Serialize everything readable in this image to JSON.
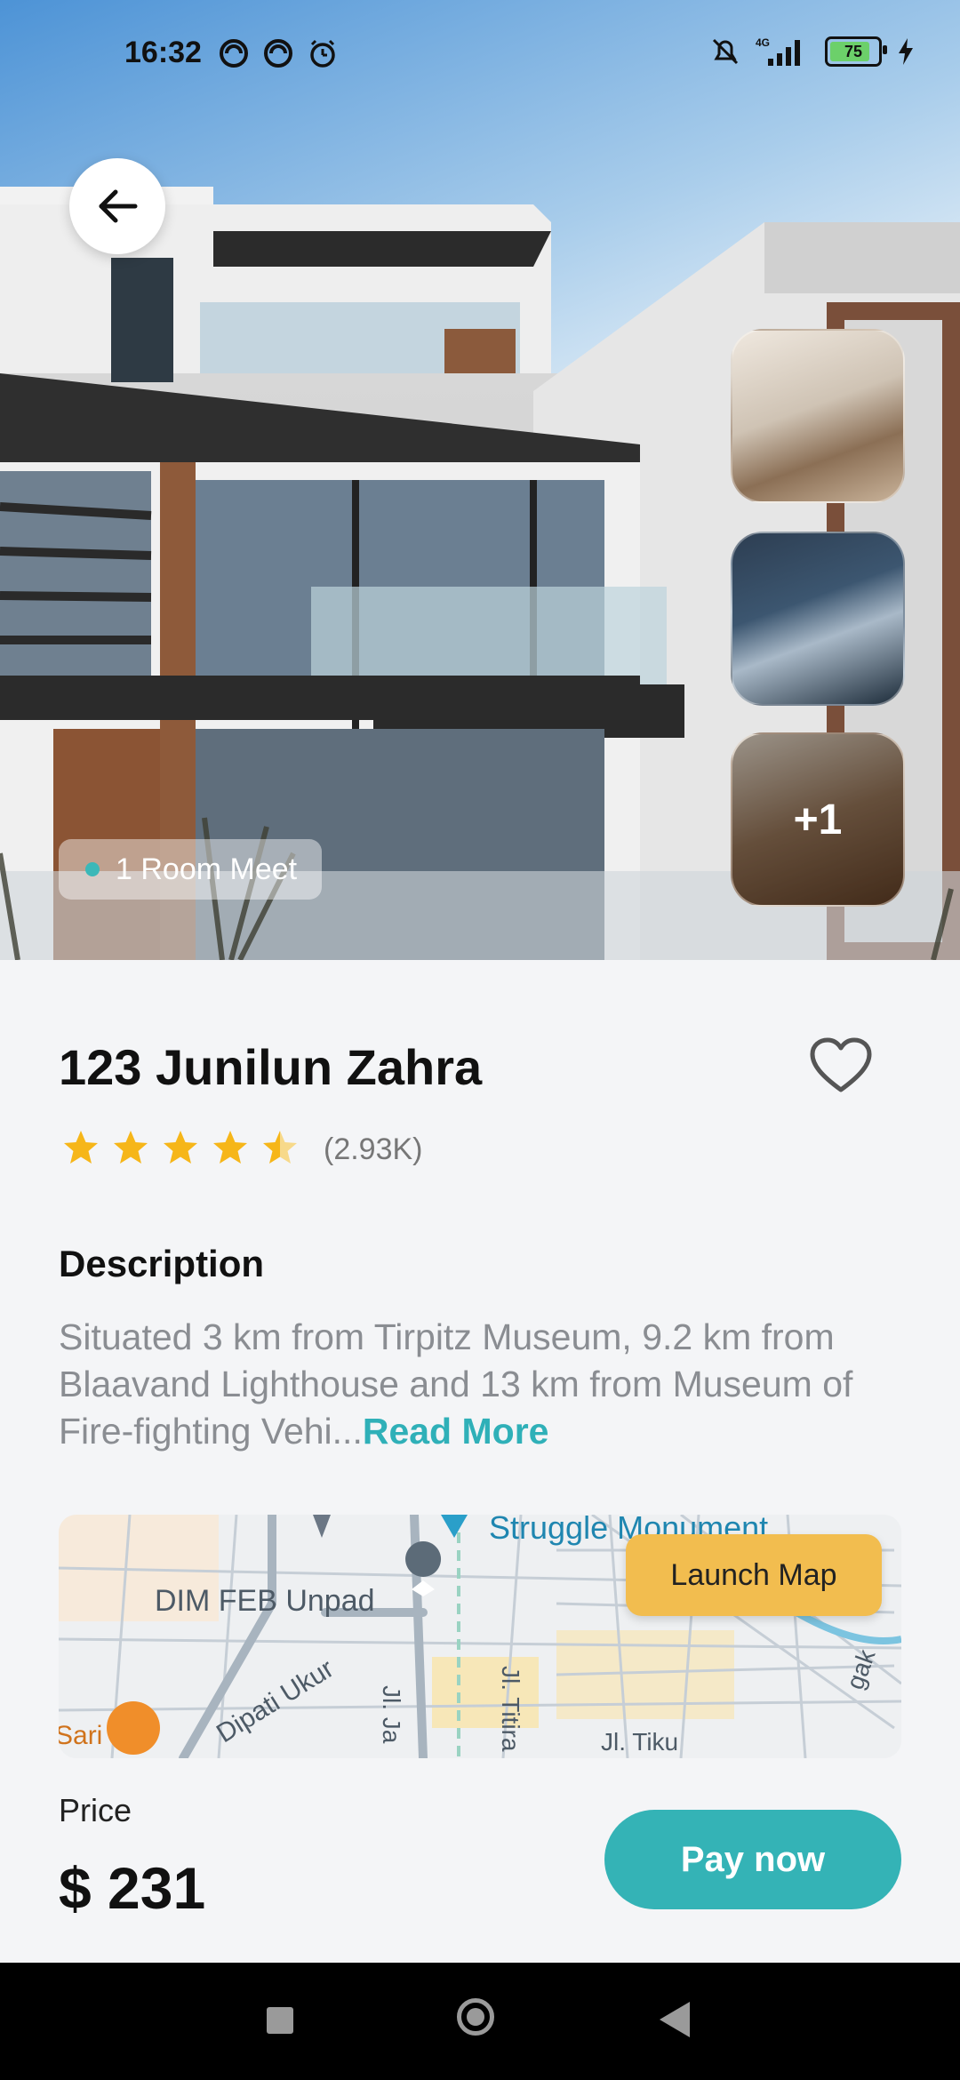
{
  "status_bar": {
    "time": "16:32",
    "battery_level": "75",
    "network": "4G",
    "icons_left": [
      "sync-icon",
      "sync-icon",
      "alarm-icon"
    ],
    "icons_right": [
      "mute-icon",
      "network-4g-icon",
      "signal-icon",
      "battery-icon",
      "charging-icon"
    ]
  },
  "hero": {
    "room_tag": "1 Room Meet",
    "more_photos_label": "+1",
    "thumbnails": [
      "living-room",
      "meeting-room",
      "staircase"
    ]
  },
  "property": {
    "title": "123 Junilun Zahra",
    "rating": 4.5,
    "rating_max": 5,
    "rating_count": "(2.93K)"
  },
  "description": {
    "heading": "Description",
    "text": "Situated 3 km from Tirpitz Museum, 9.2 km from Blaavand Lighthouse and 13 km from Museum of Fire-fighting Vehi...",
    "read_more": "Read More"
  },
  "map": {
    "labels": {
      "monument": "Struggle Monument",
      "campus": "DIM FEB Unpad",
      "road1": "Dipati Ukur",
      "road2": "Jl. Titira",
      "road3": "Jl. Tiku",
      "road4": "Jl. Ja",
      "road5": "Sari",
      "road6": "gak"
    },
    "launch_label": "Launch Map"
  },
  "checkout": {
    "price_label": "Price",
    "price_value": "$ 231",
    "pay_label": "Pay now"
  },
  "colors": {
    "accent": "#34b3b6",
    "star": "#f6b619",
    "launch": "#f2bd4f"
  }
}
